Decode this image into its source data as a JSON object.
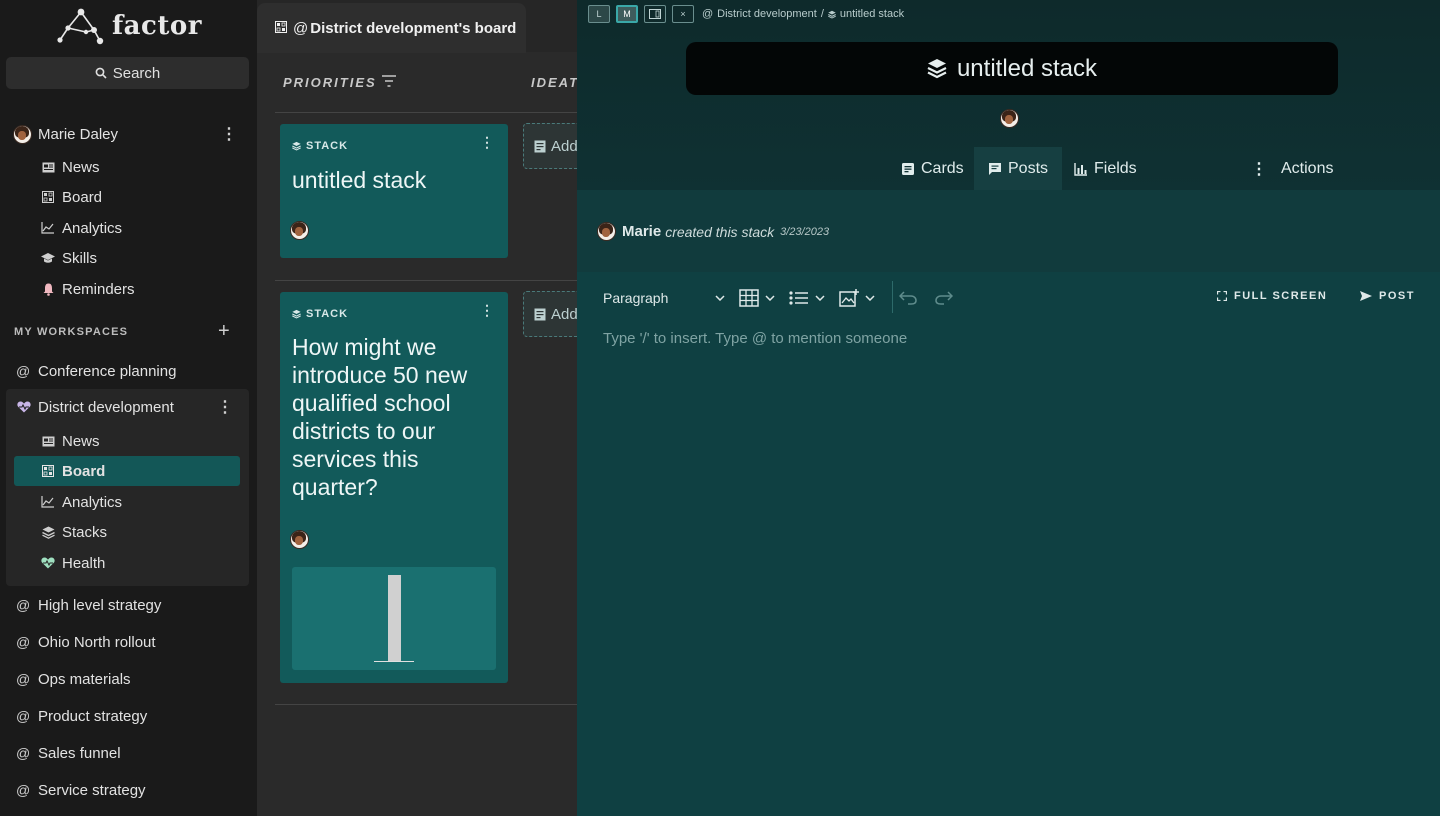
{
  "app": {
    "name": "factor"
  },
  "sidebar": {
    "search_label": "Search",
    "user": {
      "name": "Marie Daley"
    },
    "user_items": [
      {
        "label": "News",
        "icon": "newspaper-icon"
      },
      {
        "label": "Board",
        "icon": "board-grid-icon"
      },
      {
        "label": "Analytics",
        "icon": "analytics-chart-icon"
      },
      {
        "label": "Skills",
        "icon": "graduation-cap-icon"
      },
      {
        "label": "Reminders",
        "icon": "bell-icon"
      }
    ],
    "section_label": "MY WORKSPACES",
    "workspaces_top": [
      {
        "label": "Conference planning"
      }
    ],
    "active_workspace": {
      "label": "District development",
      "items": [
        {
          "label": "News",
          "icon": "newspaper-icon"
        },
        {
          "label": "Board",
          "icon": "board-grid-icon",
          "selected": true
        },
        {
          "label": "Analytics",
          "icon": "analytics-chart-icon"
        },
        {
          "label": "Stacks",
          "icon": "stack-icon"
        },
        {
          "label": "Health",
          "icon": "heart-pulse-icon"
        }
      ]
    },
    "workspaces_bottom": [
      {
        "label": "High level strategy"
      },
      {
        "label": "Ohio North rollout"
      },
      {
        "label": "Ops materials"
      },
      {
        "label": "Product strategy"
      },
      {
        "label": "Sales funnel"
      },
      {
        "label": "Service strategy"
      }
    ]
  },
  "board": {
    "tab_title": "District development's board",
    "columns": [
      {
        "label": "PRIORITIES"
      },
      {
        "label": "IDEATI"
      }
    ],
    "add_label": "Add",
    "cards": [
      {
        "tag": "STACK",
        "title": "untitled stack"
      },
      {
        "tag": "STACK",
        "title_lines": [
          "How might we",
          "introduce 50 new",
          "qualified school",
          "districts to our",
          "services this",
          "quarter?"
        ]
      }
    ]
  },
  "panel": {
    "size_buttons": [
      "L",
      "M",
      "",
      "×"
    ],
    "breadcrumb": {
      "workspace": "District development",
      "separator": "/",
      "item": "untitled stack"
    },
    "title": "untitled stack",
    "tabs": [
      {
        "label": "Cards",
        "icon": "card-icon"
      },
      {
        "label": "Posts",
        "icon": "chat-icon",
        "active": true
      },
      {
        "label": "Fields",
        "icon": "bar-chart-icon"
      }
    ],
    "actions_label": "Actions",
    "activity": {
      "user": "Marie",
      "action": "created this stack",
      "date": "3/23/2023"
    },
    "editor": {
      "block_type": "Paragraph",
      "full_screen_label": "FULL SCREEN",
      "post_label": "POST",
      "placeholder": "Type '/' to insert. Type @ to mention someone"
    }
  },
  "colors": {
    "accent": "#135757",
    "panel_bg": "#113b3d",
    "card_bg": "#125a5a"
  }
}
